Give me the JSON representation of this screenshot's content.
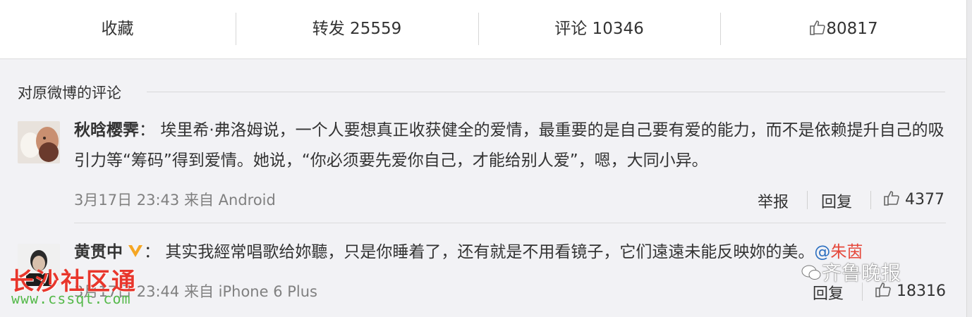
{
  "actions": {
    "favorite": "收藏",
    "repost": "转发 25559",
    "comment": "评论 10346",
    "like_count": "80817"
  },
  "section_title": "对原微博的评论",
  "comments": [
    {
      "user": "秋晗樱霁",
      "separator": "：",
      "text": "埃里希·弗洛姆说，一个人要想真正收获健全的爱情，最重要的是自己要有爱的能力，而不是依赖提升自己的吸引力等“筹码”得到爱情。她说，“你必须要先爱你自己，才能给别人爱”，嗯，大同小异。",
      "time": "3月17日 23:43",
      "from_label": "来自",
      "source": "Android",
      "report": "举报",
      "reply": "回复",
      "likes": "4377"
    },
    {
      "user": "黄贯中",
      "separator": "：",
      "text": "其实我經常唱歌给妳聽，只是你睡着了，还有就是不用看镜子，它们遠遠未能反映妳的美。",
      "mention_at": "@",
      "mention_name": "朱茵",
      "time": "3月17日 23:44",
      "from_label": "来自",
      "source": "iPhone 6 Plus",
      "reply": "回复",
      "likes": "18316"
    }
  ],
  "watermarks": {
    "left_title": "长沙社区通",
    "left_url": "www.cssqt.com",
    "right": "齐鲁晚报"
  },
  "colors": {
    "link_blue": "#2b6fc0",
    "verified_orange": "#f5a623",
    "meta_gray": "#808080"
  }
}
